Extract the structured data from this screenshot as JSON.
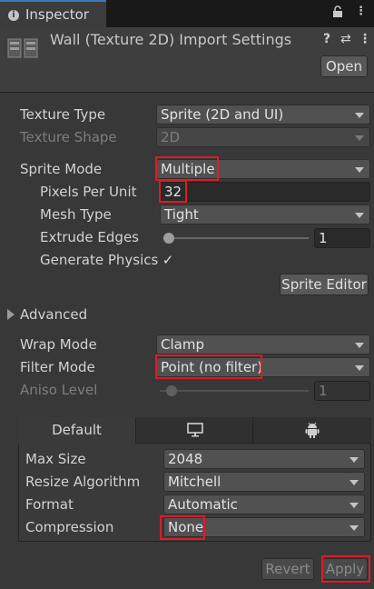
{
  "tab": {
    "title": "Inspector",
    "icon": "info-icon"
  },
  "header": {
    "title": "Wall (Texture 2D) Import Settings",
    "open_label": "Open",
    "icons": [
      "help-icon",
      "presets-icon",
      "more-menu-icon"
    ]
  },
  "fields": {
    "texture_type": {
      "label": "Texture Type",
      "value": "Sprite (2D and UI)"
    },
    "texture_shape": {
      "label": "Texture Shape",
      "value": "2D"
    },
    "sprite_mode": {
      "label": "Sprite Mode",
      "value": "Multiple"
    },
    "pixels_per_unit": {
      "label": "Pixels Per Unit",
      "value": "32"
    },
    "mesh_type": {
      "label": "Mesh Type",
      "value": "Tight"
    },
    "extrude_edges": {
      "label": "Extrude Edges",
      "value": "1"
    },
    "generate_physics": {
      "label": "Generate Physics",
      "checked": true,
      "mark": "✓"
    },
    "sprite_editor_label": "Sprite Editor",
    "advanced_label": "Advanced",
    "wrap_mode": {
      "label": "Wrap Mode",
      "value": "Clamp"
    },
    "filter_mode": {
      "label": "Filter Mode",
      "value": "Point (no filter)"
    },
    "aniso_level": {
      "label": "Aniso Level",
      "value": "1"
    }
  },
  "platform": {
    "tabs": [
      {
        "label": "Default",
        "active": true
      },
      {
        "icon": "monitor-icon"
      },
      {
        "icon": "android-icon"
      }
    ],
    "max_size": {
      "label": "Max Size",
      "value": "2048"
    },
    "resize_algorithm": {
      "label": "Resize Algorithm",
      "value": "Mitchell"
    },
    "format": {
      "label": "Format",
      "value": "Automatic"
    },
    "compression": {
      "label": "Compression",
      "value": "None"
    }
  },
  "footer": {
    "revert_label": "Revert",
    "apply_label": "Apply"
  },
  "colors": {
    "highlight": "#e01a24",
    "tab_accent": "#3a79bb"
  }
}
